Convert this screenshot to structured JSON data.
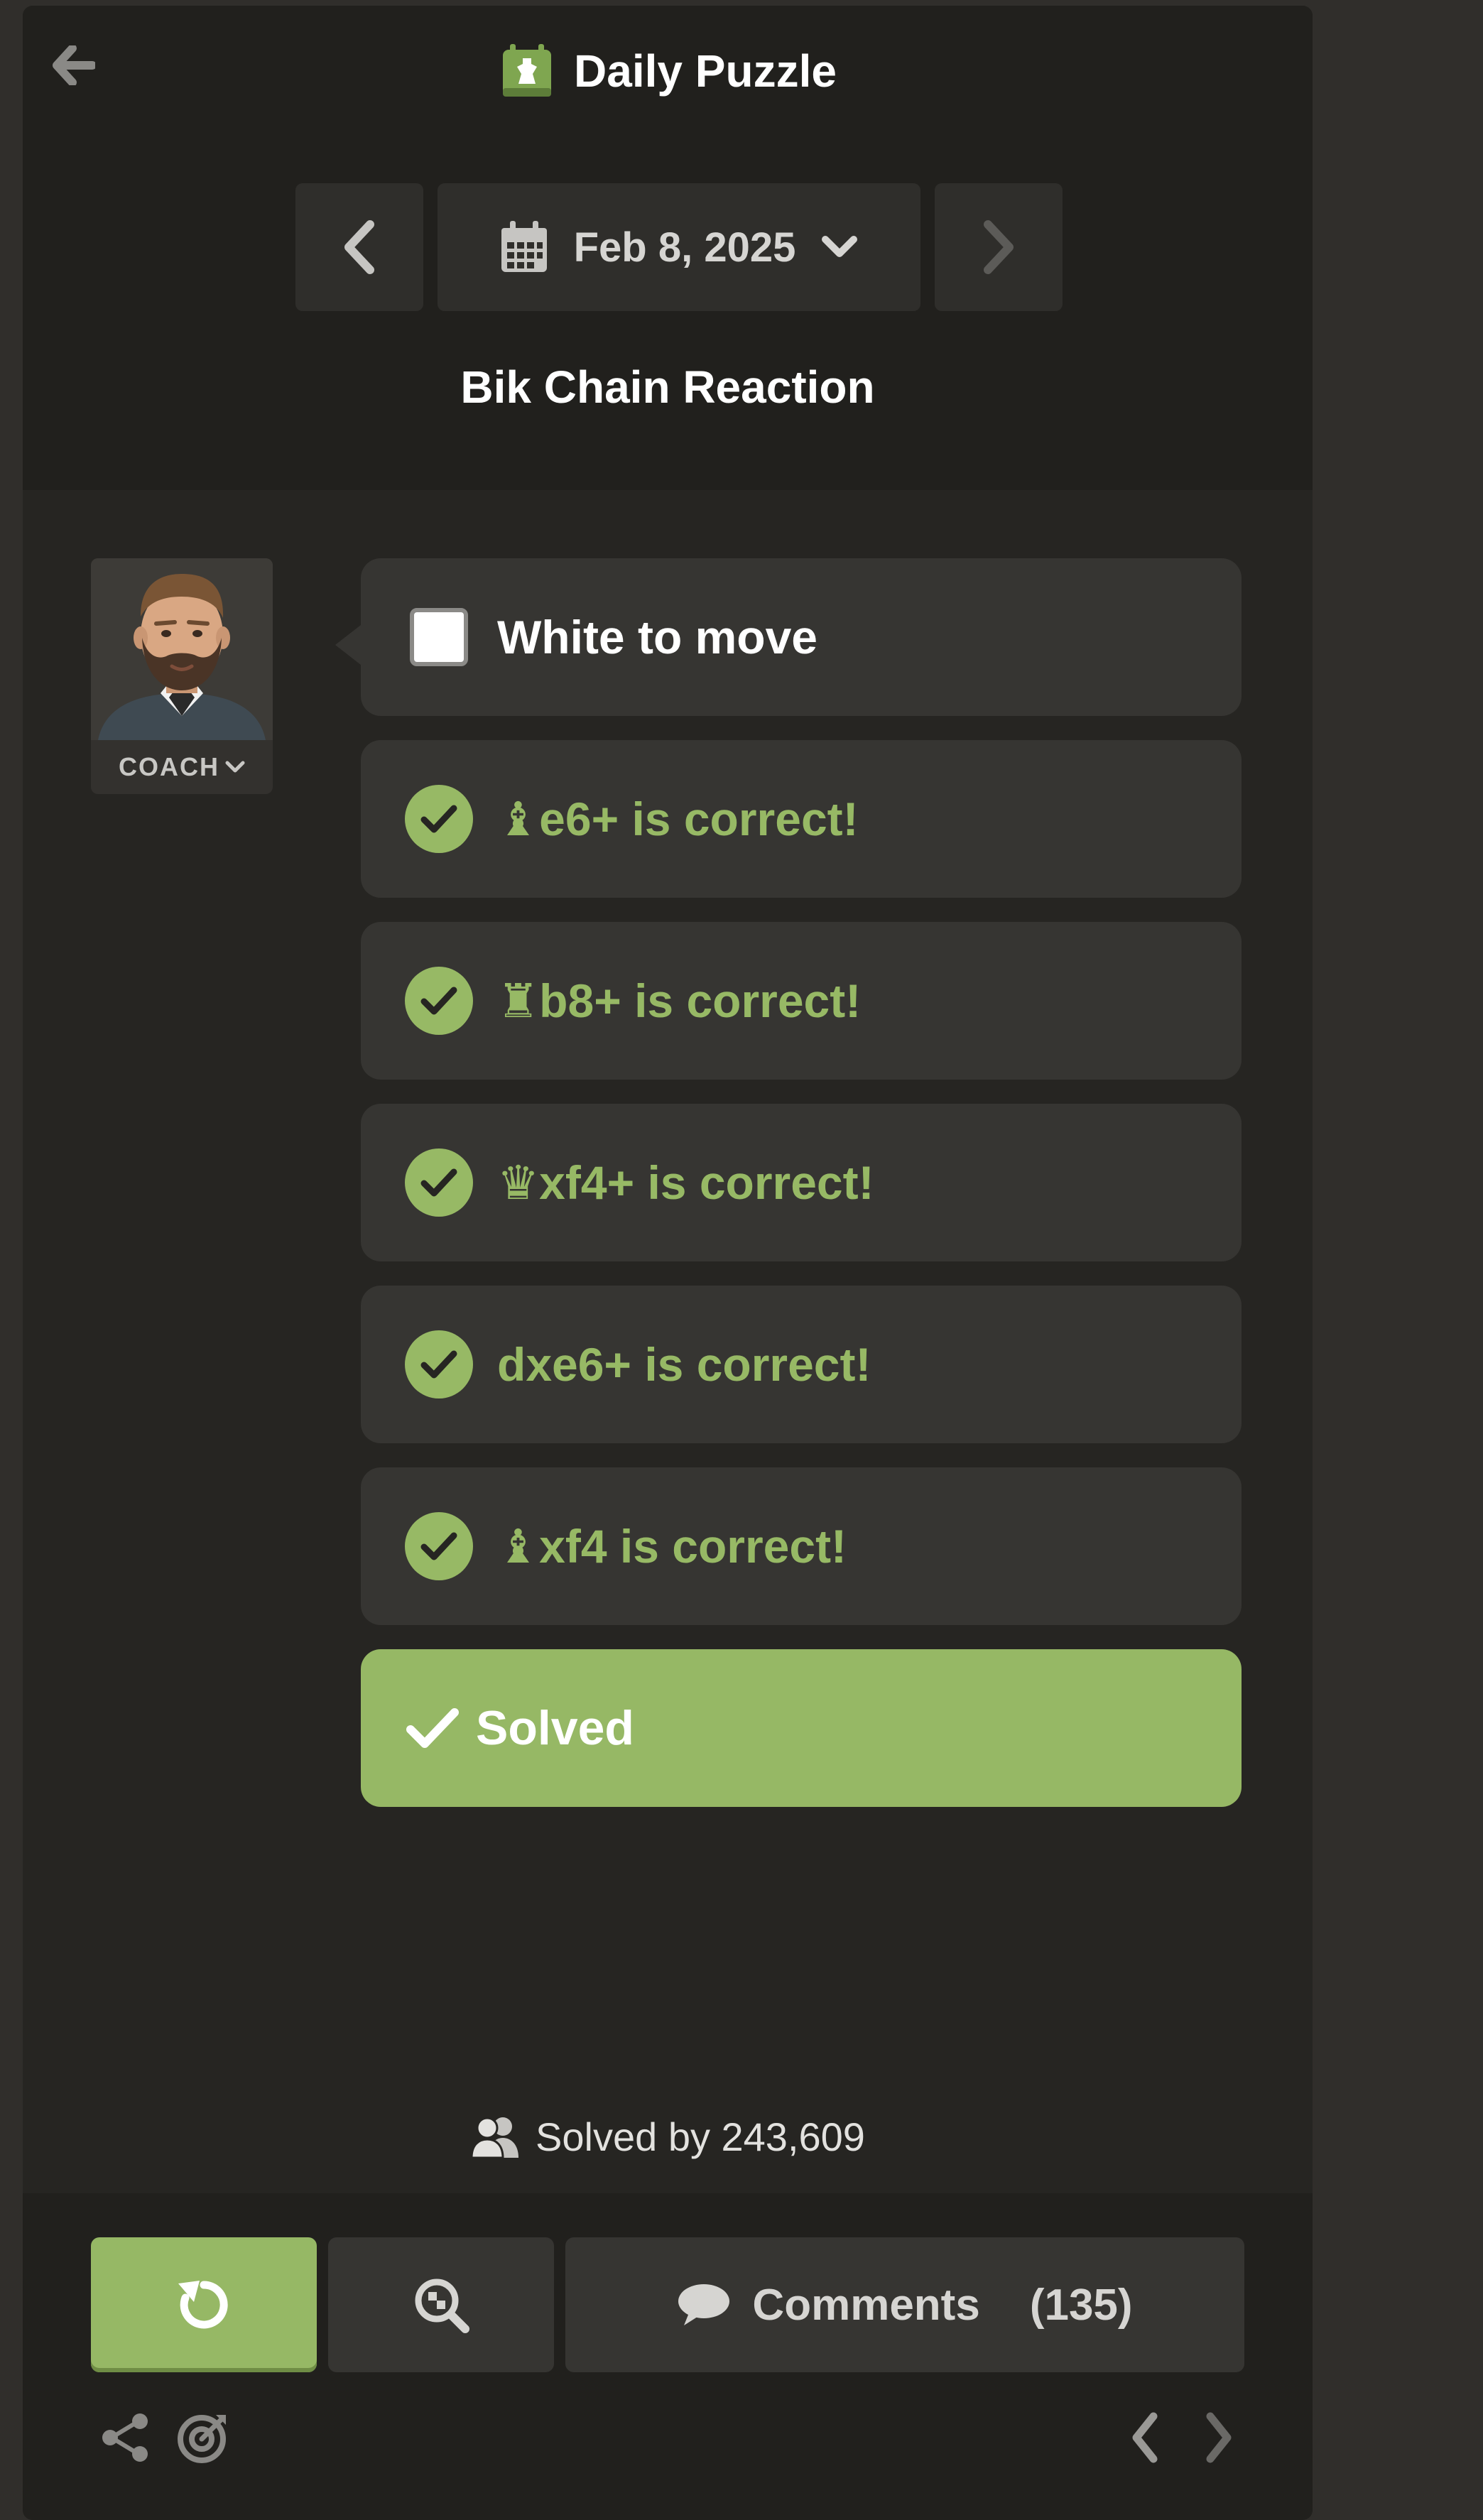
{
  "header": {
    "title": "Daily Puzzle",
    "date": "Feb 8, 2025",
    "puzzle_title": "Bik Chain Reaction"
  },
  "coach": {
    "label": "COACH"
  },
  "messages": [
    {
      "type": "prompt",
      "text": "White to move"
    },
    {
      "type": "correct",
      "piece": "♝",
      "text": "e6+ is correct!"
    },
    {
      "type": "correct",
      "piece": "♜",
      "text": "b8+ is correct!"
    },
    {
      "type": "correct",
      "piece": "♛",
      "text": "xf4+ is correct!"
    },
    {
      "type": "correct",
      "piece": "",
      "text": "dxe6+ is correct!"
    },
    {
      "type": "correct",
      "piece": "♝",
      "text": "xf4 is correct!"
    }
  ],
  "solved_banner": {
    "text": "Solved"
  },
  "stats": {
    "solved_by": "Solved by 243,609"
  },
  "footer": {
    "comments_label": "Comments",
    "comments_count": "(135)"
  },
  "colors": {
    "accent_green": "#96b865",
    "correct_text": "#97b965",
    "panel_bg": "#262522",
    "header_bg": "#21201d",
    "card_bg": "#363532"
  },
  "icons": [
    "back-arrow-icon",
    "daily-puzzle-icon",
    "chevron-left-icon",
    "calendar-icon",
    "chevron-down-icon",
    "chevron-right-icon",
    "check-circle-icon",
    "checkmark-icon",
    "users-icon",
    "retry-icon",
    "analysis-icon",
    "comment-icon",
    "share-icon",
    "target-icon"
  ]
}
